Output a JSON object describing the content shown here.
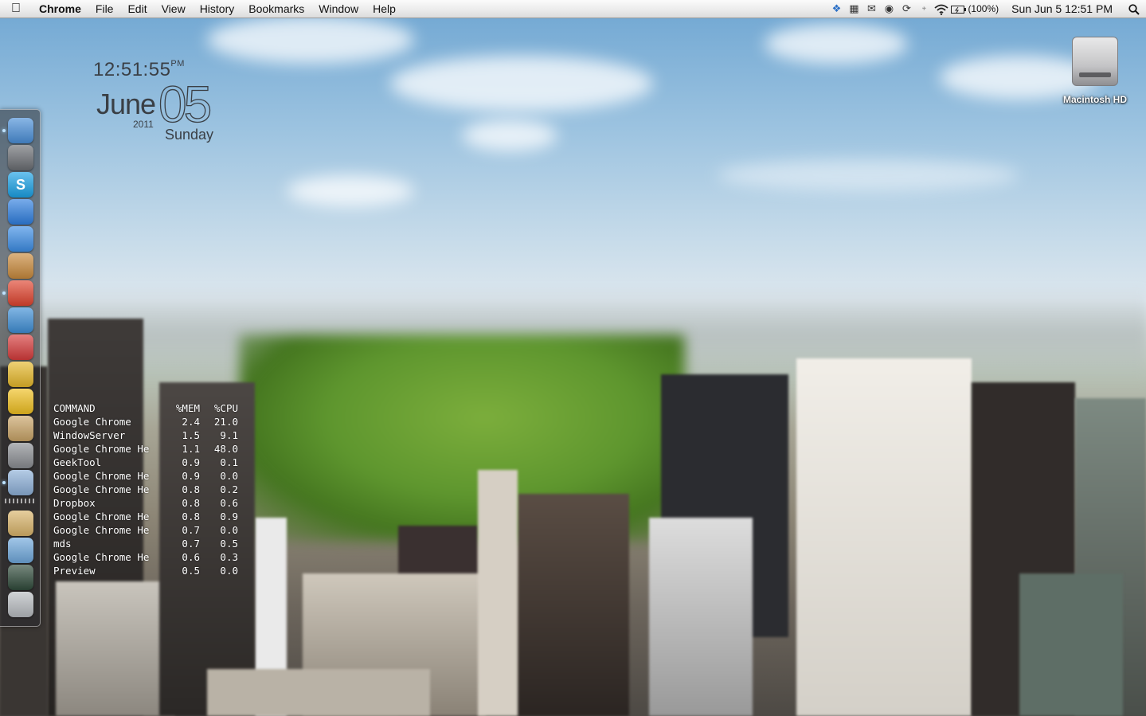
{
  "menubar": {
    "apple_icon": "apple-icon",
    "app_name": "Chrome",
    "menus": [
      "File",
      "Edit",
      "View",
      "History",
      "Bookmarks",
      "Window",
      "Help"
    ],
    "status_icons": [
      "dropbox-icon",
      "calendar-icon",
      "mail-icon",
      "eye-icon",
      "sync-icon",
      "bluetooth-icon",
      "wifi-icon",
      "battery-icon"
    ],
    "battery_percent": "(100%)",
    "datetime": "Sun Jun 5  12:51 PM",
    "spotlight_icon": "spotlight-search-icon"
  },
  "clock_widget": {
    "time": "12:51:55",
    "ampm": "PM",
    "month": "June",
    "day": "05",
    "year": "2011",
    "weekday": "Sunday"
  },
  "processes": {
    "headers": [
      "COMMAND",
      "%MEM",
      "%CPU"
    ],
    "rows": [
      [
        "Google Chrome",
        "2.4",
        "21.0"
      ],
      [
        "WindowServer",
        "1.5",
        "9.1"
      ],
      [
        "Google Chrome He",
        "1.1",
        "48.0"
      ],
      [
        "GeekTool",
        "0.9",
        "0.1"
      ],
      [
        "Google Chrome He",
        "0.9",
        "0.0"
      ],
      [
        "Google Chrome He",
        "0.8",
        "0.2"
      ],
      [
        "Dropbox",
        "0.8",
        "0.6"
      ],
      [
        "Google Chrome He",
        "0.8",
        "0.9"
      ],
      [
        "Google Chrome He",
        "0.7",
        "0.0"
      ],
      [
        "mds",
        "0.7",
        "0.5"
      ],
      [
        "Google Chrome He",
        "0.6",
        "0.3"
      ],
      [
        "Preview",
        "0.5",
        "0.0"
      ]
    ]
  },
  "dock": {
    "items": [
      {
        "name": "finder-icon",
        "color": "#4a8fd8",
        "running": true
      },
      {
        "name": "facetime-icon",
        "color": "#6b6e73",
        "running": false
      },
      {
        "name": "skype-icon",
        "color": "#1aa1e5",
        "running": false,
        "glyph": "S"
      },
      {
        "name": "app-store-icon",
        "color": "#2f7fe0",
        "running": false
      },
      {
        "name": "itunes-icon",
        "color": "#3d8ee6",
        "running": false
      },
      {
        "name": "iphoto-icon",
        "color": "#c98a3c",
        "running": false
      },
      {
        "name": "chrome-icon",
        "color": "#e0442f",
        "running": true
      },
      {
        "name": "safari-icon",
        "color": "#3f8fd6",
        "running": false
      },
      {
        "name": "photo-booth-icon",
        "color": "#d63b3b",
        "running": false
      },
      {
        "name": "pinwheel-icon",
        "color": "#e6b82a",
        "running": false
      },
      {
        "name": "cyberduck-icon",
        "color": "#f0c020",
        "running": false
      },
      {
        "name": "address-book-icon",
        "color": "#c9a467",
        "running": false
      },
      {
        "name": "system-preferences-icon",
        "color": "#8a8d92",
        "running": false
      },
      {
        "name": "preview-icon",
        "color": "#8db0d8",
        "running": true
      },
      {
        "name": "documents-folder-icon",
        "color": "#d9b46a",
        "running": false
      },
      {
        "name": "applications-folder-icon",
        "color": "#6fa8dc",
        "running": false
      },
      {
        "name": "activity-monitor-icon",
        "color": "#2f4a3a",
        "running": false
      },
      {
        "name": "trash-icon",
        "color": "#b8bcc0",
        "running": false
      }
    ]
  },
  "desktop_icons": [
    {
      "label": "Macintosh HD",
      "icon": "hard-drive-icon"
    }
  ]
}
